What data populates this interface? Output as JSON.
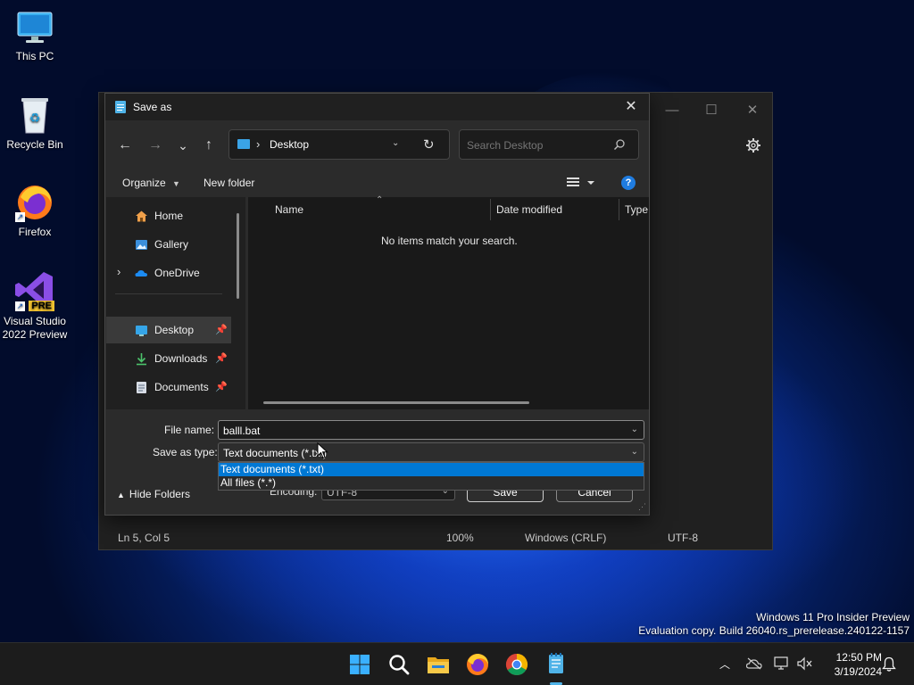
{
  "desktop": {
    "icons": [
      {
        "label": "This PC",
        "icon": "monitor-icon"
      },
      {
        "label": "Recycle Bin",
        "icon": "recycle-bin-icon"
      },
      {
        "label": "Firefox",
        "icon": "firefox-icon"
      },
      {
        "label": "Visual Studio 2022 Preview",
        "icon": "visual-studio-icon",
        "badge": "PRE"
      }
    ],
    "watermark": {
      "line1": "Windows 11 Pro Insider Preview",
      "line2": "Evaluation copy. Build 26040.rs_prerelease.240122-1157"
    }
  },
  "notepad": {
    "status": {
      "position": "Ln 5, Col 5",
      "zoom": "100%",
      "line_endings": "Windows (CRLF)",
      "encoding": "UTF-8"
    },
    "controls": {
      "minimize": "—",
      "maximize": "☐",
      "close": "✕"
    }
  },
  "dialog": {
    "title": "Save as",
    "nav": {
      "back": "←",
      "forward": "→",
      "recent": "⌄",
      "up": "↑"
    },
    "address": {
      "separator": "›",
      "location": "Desktop",
      "refresh": "↻"
    },
    "search": {
      "placeholder": "Search Desktop"
    },
    "toolbar": {
      "organize": "Organize",
      "new_folder": "New folder",
      "help": "?"
    },
    "nav_pane": {
      "items": [
        {
          "label": "Home",
          "icon": "home-icon",
          "pinned": false
        },
        {
          "label": "Gallery",
          "icon": "gallery-icon",
          "pinned": false
        },
        {
          "label": "OneDrive",
          "icon": "onedrive-icon",
          "pinned": false,
          "expandable": true
        },
        {
          "label": "Desktop",
          "icon": "desktop-folder-icon",
          "pinned": true,
          "selected": true
        },
        {
          "label": "Downloads",
          "icon": "download-icon",
          "pinned": true
        },
        {
          "label": "Documents",
          "icon": "documents-icon",
          "pinned": true
        }
      ]
    },
    "columns": [
      "Name",
      "Date modified",
      "Type"
    ],
    "empty_message": "No items match your search.",
    "file_name_label": "File name:",
    "file_name_value": "balll.bat",
    "save_type_label": "Save as type:",
    "save_type_value": "Text documents (*.txt)",
    "save_type_options": [
      "Text documents (*.txt)",
      "All files  (*.*)"
    ],
    "encoding_label": "Encoding:",
    "encoding_value": "UTF-8",
    "hide_folders": "Hide Folders",
    "save_button": "Save",
    "cancel_button": "Cancel"
  },
  "taskbar": {
    "apps": [
      "windows-start-icon",
      "search-icon",
      "file-explorer-icon",
      "firefox-icon",
      "chrome-icon",
      "notepad-icon"
    ],
    "time": "12:50 PM",
    "date": "3/19/2024",
    "tray_icons": [
      "chevron-up-icon",
      "onedrive-offline-icon",
      "network-icon",
      "volume-muted-icon",
      "notification-bell-icon"
    ]
  },
  "colors": {
    "accent": "#0a6ad6",
    "selection": "#0078d4",
    "dialog_bg": "#2b2b2b"
  }
}
